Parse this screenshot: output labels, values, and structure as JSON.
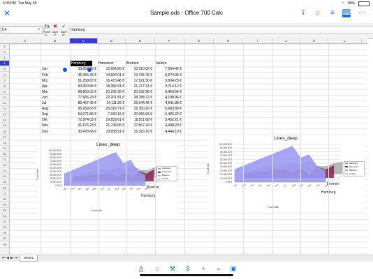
{
  "status_bar": {
    "time": "5:39 PM",
    "date": "Tue May 28",
    "battery": "80%"
  },
  "title_bar": {
    "title": "Sample.ods - Office 700 Calc"
  },
  "formula_bar": {
    "cell_ref": "C4",
    "function_label": "Functi",
    "cancel_label": "Canc",
    "accept_label": "Acce",
    "sub_label_1": "fi...",
    "sub_label_2": "el",
    "sub_label_3": "pt",
    "content": "Hamburg"
  },
  "columns": [
    "A",
    "B",
    "C",
    "D",
    "E",
    "F",
    "G",
    "H",
    "I",
    "J",
    "K",
    "L"
  ],
  "selected_column": "C",
  "rows": [
    "1",
    "2",
    "3",
    "4",
    "5",
    "6",
    "7",
    "8",
    "9",
    "10",
    "11",
    "12",
    "13",
    "14",
    "15",
    "16",
    "17",
    "18",
    "19",
    "20",
    "21",
    "22",
    "23",
    "24",
    "25",
    "26",
    "27",
    "28",
    "29",
    "30",
    "31",
    "32",
    "33",
    "34",
    "35",
    "36"
  ],
  "selected_row": "4",
  "table": {
    "headers": [
      "Hamburg",
      "Hannover",
      "Bremen",
      "Uelzen"
    ],
    "months": [
      "Jan",
      "Feb",
      "Mrz",
      "Apr",
      "Mai",
      "Jun",
      "Jul",
      "Aug",
      "Sep",
      "Okt",
      "Nov",
      "Dez"
    ],
    "values": [
      [
        "33,654.00 €",
        "12,654.56 €",
        "10,010.02 €",
        "7,654.45 €"
      ],
      [
        "42,456.43 €",
        "14,564.01 €",
        "13,765.76 €",
        "5,674.34 €"
      ],
      [
        "51,258.63 €",
        "16,473.46 €",
        "17,521.50 €",
        "3,694.23 €"
      ],
      [
        "60,060.83 €",
        "18,382.91 €",
        "21,277.24 €",
        "2,714.12 €"
      ],
      [
        "68,863.03 €",
        "20,292.36 €",
        "20,032.98 €",
        "3,456.54 €"
      ],
      [
        "77,665.23 €",
        "22,201.81 €",
        "28,788.72 €",
        "4,198.96 €"
      ],
      [
        "86,467.43 €",
        "14,111.26 €",
        "22,544.46 €",
        "4,941.38 €"
      ],
      [
        "95,269.63 €",
        "26,020.71 €",
        "32,300.20 €",
        "5,683.80 €"
      ],
      [
        "64,071.83 €",
        "7,930.16 €",
        "20,055.94 €",
        "6,426.22 €"
      ],
      [
        "72,874.03 €",
        "29,839.61 €",
        "18,811.68 €",
        "5,432.21 €"
      ],
      [
        "41,676.23 €",
        "21,749.06 €",
        "27,567.42 €",
        "4,438.20 €"
      ],
      [
        "30,478.43 €",
        "33,658.51 €",
        "31,323.16 €",
        "4,444.19 €"
      ]
    ]
  },
  "charts": [
    {
      "title": "Lines_deep",
      "ylabel": "Y axis title",
      "xlabel": "X axis title",
      "y_ticks": [
        "100,000.00 €",
        "90,000.00 €",
        "80,000.00 €",
        "70,000.00 €",
        "60,000.00 €",
        "50,000.00 €",
        "40,000.00 €",
        "30,000.00 €",
        "20,000.00 €",
        "10,000.00 €",
        "0.00 €"
      ],
      "x_ticks": [
        "Jan",
        "Feb",
        "Mrz",
        "Apr",
        "Mai",
        "Jun",
        "Jul",
        "Aug",
        "Sep",
        "Okt",
        "Nov",
        "Dez"
      ],
      "z_labels": [
        "Bremen",
        "Hamburg"
      ],
      "legend": [
        "Hamburg",
        "Hannover",
        "Bremen",
        "Uelzen"
      ]
    },
    {
      "title": "Lines_deep",
      "ylabel": "Y axis title",
      "xlabel": "X axis title",
      "y_ticks": [
        "100,000.00 €",
        "90,000.00 €",
        "80,000.00 €",
        "70,000.00 €",
        "60,000.00 €",
        "50,000.00 €",
        "40,000.00 €",
        "30,000.00 €",
        "20,000.00 €",
        "10,000.00 €",
        "0.00 €"
      ],
      "x_ticks": [
        "Jan",
        "Feb",
        "Mrz",
        "Apr",
        "Mai",
        "Jun",
        "Jul",
        "Aug",
        "Sep",
        "Okt",
        "Nov",
        "Dez"
      ],
      "z_labels": [
        "Bremen",
        "Hamburg"
      ],
      "legend": [
        "Hamburg",
        "Hannover",
        "Bremen",
        "Uelzen"
      ]
    }
  ],
  "series_colors": {
    "Hamburg": "#9b9bf2",
    "Hannover": "#8c2a5a",
    "Bremen": "#b0b0b0",
    "Uelzen": "#c9c9c9",
    "accent": "#1f6fd1",
    "selection": "#3b3bd0"
  },
  "sheet_tabs": {
    "active": "Sheet1"
  },
  "toolbar_icons": [
    "text-format-icon",
    "home-icon",
    "wrench-icon",
    "currency-icon",
    "add-icon",
    "search-icon",
    "image-icon"
  ]
}
